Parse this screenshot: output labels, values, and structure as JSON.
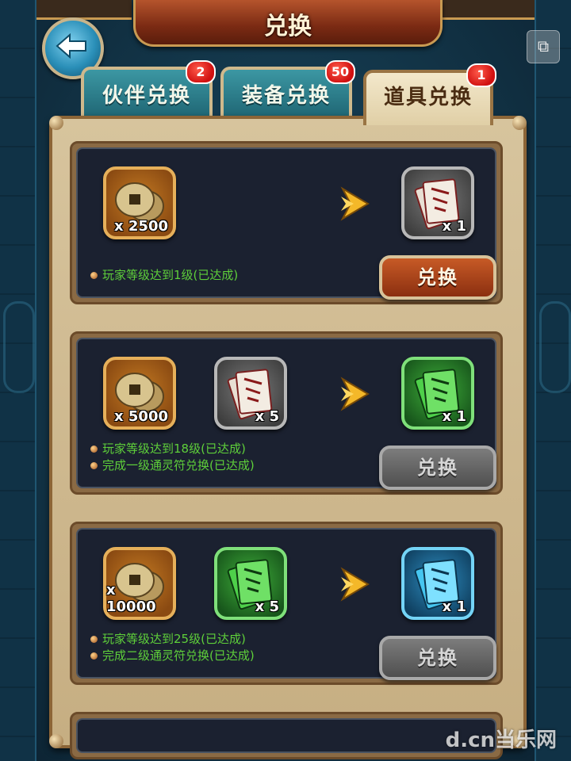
{
  "header": {
    "title": "兑换",
    "back_icon": "back-arrow-icon",
    "corner_icon": "window-icon",
    "corner_glyph": "⧉"
  },
  "tabs": [
    {
      "label": "伙伴兑换",
      "badge": "2",
      "active": false
    },
    {
      "label": "装备兑换",
      "badge": "50",
      "active": false
    },
    {
      "label": "道具兑换",
      "badge": "1",
      "active": true
    }
  ],
  "recipes": [
    {
      "inputs": [
        {
          "item": "coins",
          "quantity": "x 2500"
        }
      ],
      "output": {
        "item": "gray-talisman",
        "quantity": "x 1"
      },
      "conditions": [
        "玩家等级达到1级(已达成)"
      ],
      "button_label": "兑换",
      "button_enabled": true
    },
    {
      "inputs": [
        {
          "item": "coins",
          "quantity": "x 5000"
        },
        {
          "item": "gray-talisman",
          "quantity": "x 5"
        }
      ],
      "output": {
        "item": "green-talisman",
        "quantity": "x 1"
      },
      "conditions": [
        "玩家等级达到18级(已达成)",
        "完成一级通灵符兑换(已达成)"
      ],
      "button_label": "兑换",
      "button_enabled": false
    },
    {
      "inputs": [
        {
          "item": "coins",
          "quantity": "x 10000"
        },
        {
          "item": "green-talisman",
          "quantity": "x 5"
        }
      ],
      "output": {
        "item": "blue-talisman",
        "quantity": "x 1"
      },
      "conditions": [
        "玩家等级达到25级(已达成)",
        "完成二级通灵符兑换(已达成)"
      ],
      "button_label": "兑换",
      "button_enabled": false
    }
  ],
  "watermark": "d.cn当乐网",
  "colors": {
    "condition_text": "#5ecf3a",
    "badge": "#d01010",
    "active_button": "#b04a1c"
  }
}
